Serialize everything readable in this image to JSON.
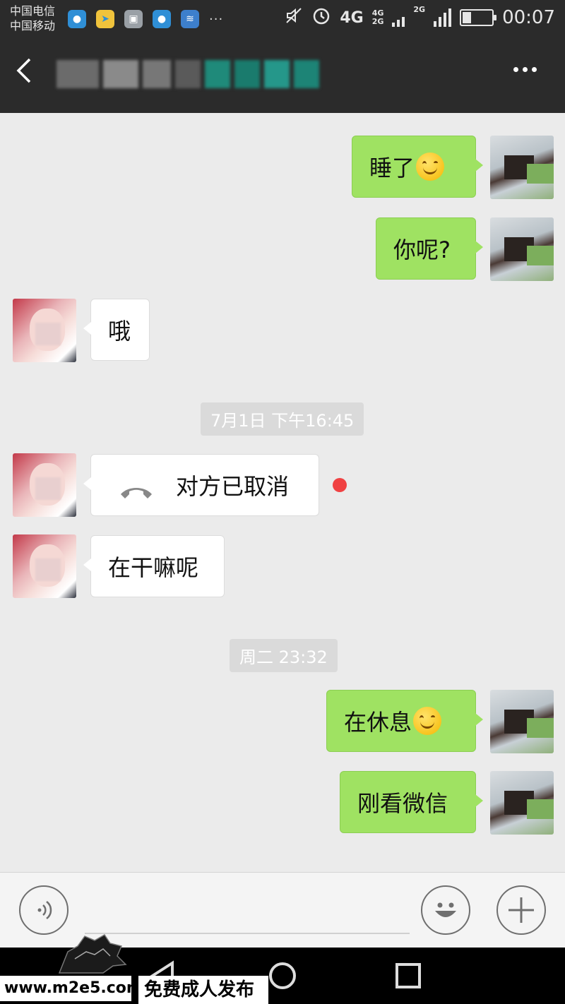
{
  "status_bar": {
    "carrier_1": "中国电信",
    "carrier_2": "中国移动",
    "more": "···",
    "network_4g": "4G",
    "network_4g_small": "4G",
    "network_2g_small": "2G",
    "network_2g": "2G",
    "battery_level": 0.3,
    "time": "00:07"
  },
  "title_bar": {
    "chat_title": "",
    "title_blurred": true
  },
  "messages": [
    {
      "side": "sent",
      "text": "睡了",
      "emoji": "smile-emoji"
    },
    {
      "side": "sent",
      "text": "你呢?"
    },
    {
      "side": "received",
      "text": "哦"
    },
    {
      "type": "timestamp",
      "text": "7月1日 下午16:45"
    },
    {
      "side": "received",
      "type": "call",
      "text": "对方已取消",
      "unread": true
    },
    {
      "side": "received",
      "text": "在干嘛呢"
    },
    {
      "type": "timestamp",
      "text": "周二 23:32"
    },
    {
      "side": "sent",
      "text": "在休息",
      "emoji": "smile-emoji"
    },
    {
      "side": "sent",
      "text": "刚看微信"
    }
  ],
  "watermark": {
    "url": "www.m2e5.com",
    "text": "免费成人发布"
  },
  "colors": {
    "sent_bubble": "#9fe262",
    "received_bubble": "#ffffff",
    "unread_dot": "#f04142",
    "header_bg": "#2b2b2b"
  }
}
